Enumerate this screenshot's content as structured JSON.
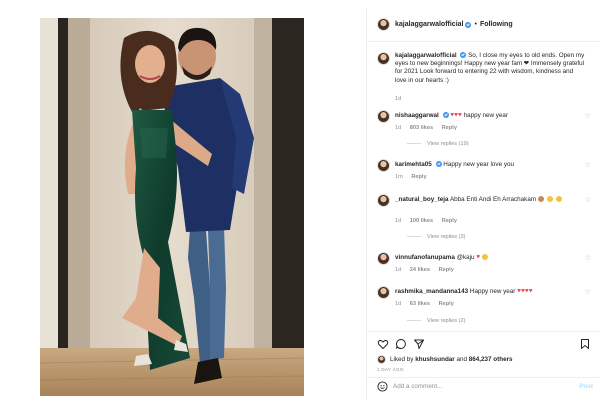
{
  "header": {
    "username": "kajalaggarwalofficial",
    "separator": "•",
    "follow_state": "Following"
  },
  "caption": {
    "username": "kajalaggarwalofficial",
    "text": "So, I close my eyes to old ends. Open my eyes to new beginnings! Happy new year fam ❤ Immensely grateful for 2021 Look forward to entering 22 with wisdom, kindness and love in our hearts :)",
    "time": "1d"
  },
  "comments": [
    {
      "username": "nishaaggarwal",
      "text": "happy new year",
      "time": "1d",
      "likes": "803 likes",
      "reply": "Reply",
      "view_replies": "View replies (19)"
    },
    {
      "username": "karimehta05",
      "text": "Happy new year love you",
      "time": "1m",
      "reply": "Reply"
    },
    {
      "username": "_natural_boy_teja",
      "text": "Abba  Enti Andi Eh Arrachakam",
      "time": "1d",
      "likes": "100 likes",
      "reply": "Reply",
      "view_replies": "View replies (3)"
    },
    {
      "username": "vinnufanofanupama",
      "text": "@kaju",
      "time": "1d",
      "likes": "24 likes",
      "reply": "Reply"
    },
    {
      "username": "rashmika_mandanna143",
      "text": "Happy new year",
      "time": "1d",
      "likes": "63 likes",
      "reply": "Reply",
      "view_replies": "View replies (2)"
    }
  ],
  "actions": {
    "liked_by_prefix": "Liked by",
    "liked_by_user": "khushsundar",
    "liked_by_and": "and",
    "liked_by_count": "864,237 others",
    "post_age": "1 DAY AGO"
  },
  "add_comment": {
    "placeholder": "Add a comment...",
    "post_label": "Post"
  },
  "colors": {
    "verified": "#3897f0",
    "heart": "#ed4956",
    "muted": "#8e8e8e",
    "post_disabled": "#b2dffc"
  }
}
